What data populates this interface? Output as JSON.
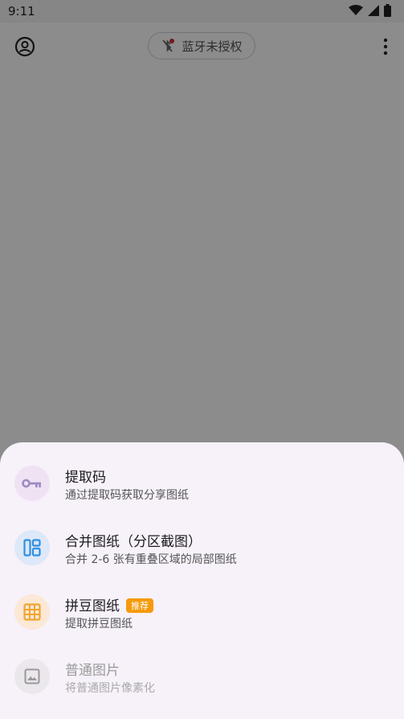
{
  "status_bar": {
    "time": "9:11"
  },
  "app_bar": {
    "bluetooth_label": "蓝牙未授权"
  },
  "sheet": {
    "items": [
      {
        "title": "提取码",
        "subtitle": "通过提取码获取分享图纸",
        "icon": "key-icon",
        "enabled": true
      },
      {
        "title": "合并图纸（分区截图）",
        "subtitle": "合并 2-6 张有重叠区域的局部图纸",
        "icon": "layout-icon",
        "enabled": true
      },
      {
        "title": "拼豆图纸",
        "badge": "推荐",
        "subtitle": "提取拼豆图纸",
        "icon": "grid-icon",
        "enabled": true
      },
      {
        "title": "普通图片",
        "subtitle": "将普通图片像素化",
        "icon": "image-icon",
        "enabled": false
      }
    ]
  },
  "colors": {
    "sheet_bg": "#f7f1fa",
    "key_icon": "#9b8ac4",
    "layout_icon": "#2f8fe0",
    "grid_icon": "#f2a531",
    "badge": "#f59a0b",
    "bt_alert": "#d0302f"
  }
}
